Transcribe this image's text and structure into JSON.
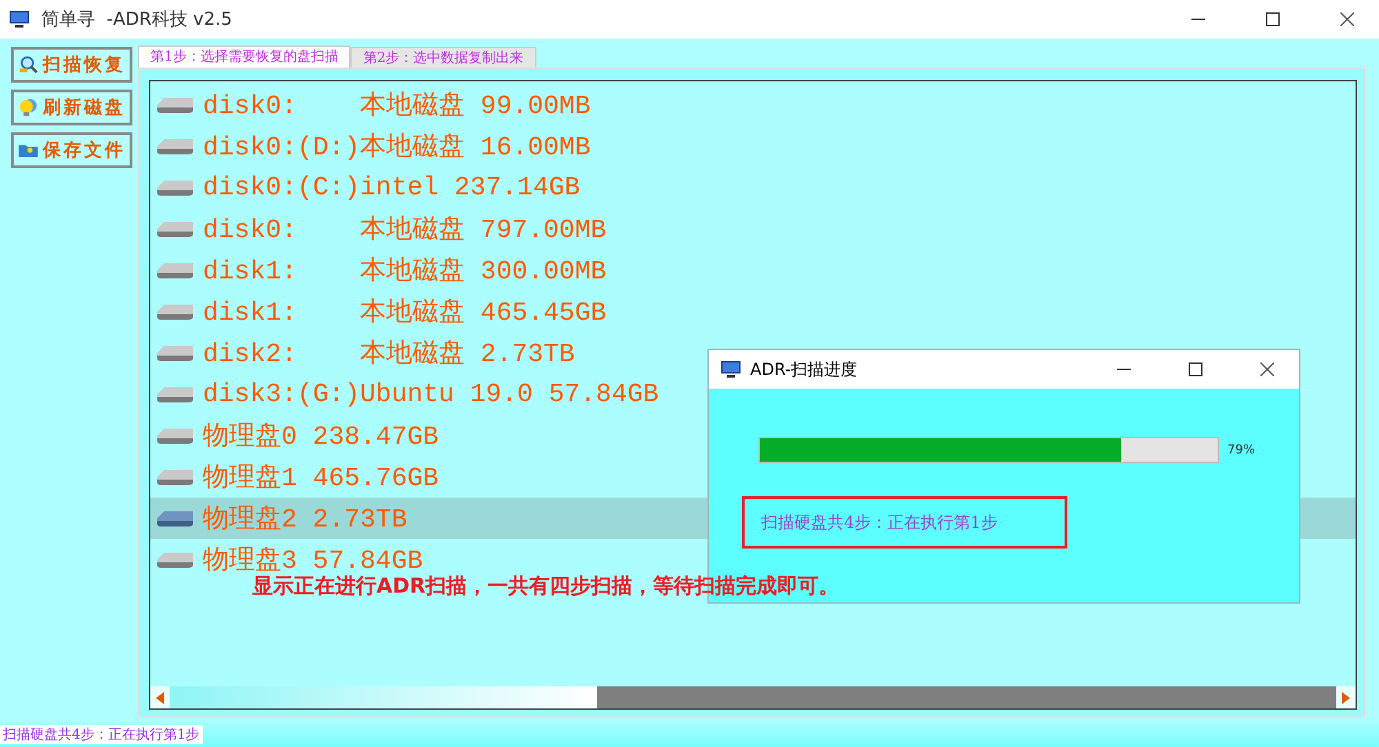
{
  "window": {
    "title": "简单寻  -ADR科技 v2.5"
  },
  "side_buttons": [
    {
      "label": "扫描恢复",
      "kind": "scan"
    },
    {
      "label": "刷新磁盘",
      "kind": "refresh"
    },
    {
      "label": "保存文件",
      "kind": "save"
    }
  ],
  "tabs": [
    {
      "label": "第1步：选择需要恢复的盘扫描",
      "selected": true
    },
    {
      "label": "第2步：选中数据复制出来",
      "selected": false
    }
  ],
  "disks": [
    {
      "label": "disk0:    本地磁盘 99.00MB",
      "selected": false
    },
    {
      "label": "disk0:(D:)本地磁盘 16.00MB",
      "selected": false
    },
    {
      "label": "disk0:(C:)intel 237.14GB",
      "selected": false
    },
    {
      "label": "disk0:    本地磁盘 797.00MB",
      "selected": false
    },
    {
      "label": "disk1:    本地磁盘 300.00MB",
      "selected": false
    },
    {
      "label": "disk1:    本地磁盘 465.45GB",
      "selected": false
    },
    {
      "label": "disk2:    本地磁盘 2.73TB",
      "selected": false
    },
    {
      "label": "disk3:(G:)Ubuntu 19.0 57.84GB",
      "selected": false
    },
    {
      "label": "物理盘0 238.47GB",
      "selected": false
    },
    {
      "label": "物理盘1 465.76GB",
      "selected": false
    },
    {
      "label": "物理盘2 2.73TB",
      "selected": true
    },
    {
      "label": "物理盘3 57.84GB",
      "selected": false
    }
  ],
  "status_bar": "扫描硬盘共4步：正在执行第1步",
  "dialog": {
    "title": "ADR-扫描进度",
    "level": 0.79,
    "percent": "79%",
    "message": "扫描硬盘共4步：正在执行第1步"
  },
  "annotation": "显示正在进行ADR扫描，一共有四步扫描，等待扫描完成即可。"
}
